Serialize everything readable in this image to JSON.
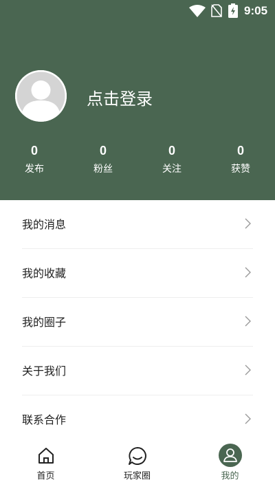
{
  "status_bar": {
    "time": "9:05"
  },
  "profile": {
    "login_text": "点击登录"
  },
  "stats": [
    {
      "value": "0",
      "label": "发布"
    },
    {
      "value": "0",
      "label": "粉丝"
    },
    {
      "value": "0",
      "label": "关注"
    },
    {
      "value": "0",
      "label": "获赞"
    }
  ],
  "menu": [
    {
      "label": "我的消息"
    },
    {
      "label": "我的收藏"
    },
    {
      "label": "我的圈子"
    },
    {
      "label": "关于我们"
    },
    {
      "label": "联系合作"
    }
  ],
  "tabs": [
    {
      "label": "首页",
      "icon": "home-icon"
    },
    {
      "label": "玩家圈",
      "icon": "chat-bubble-icon"
    },
    {
      "label": "我的",
      "icon": "user-icon",
      "active": true
    }
  ],
  "colors": {
    "primary": "#4a6651",
    "text": "#222222",
    "divider": "#eeeeee"
  }
}
